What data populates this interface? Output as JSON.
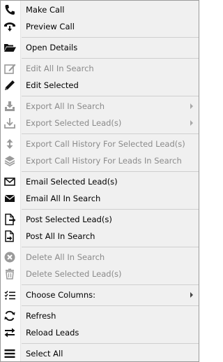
{
  "menu": {
    "make_call": "Make Call",
    "preview_call": "Preview Call",
    "open_details": "Open Details",
    "edit_all_in_search": "Edit All In Search",
    "edit_selected": "Edit Selected",
    "export_all_in_search": "Export All In Search",
    "export_selected_leads": "Export Selected Lead(s)",
    "export_call_history_selected": "Export Call History For Selected Lead(s)",
    "export_call_history_in_search": "Export Call History For Leads In Search",
    "email_selected_leads": "Email Selected Lead(s)",
    "email_all_in_search": "Email All In Search",
    "post_selected_leads": "Post Selected Lead(s)",
    "post_all_in_search": "Post All In Search",
    "delete_all_in_search": "Delete All In Search",
    "delete_selected_leads": "Delete Selected Lead(s)",
    "choose_columns": "Choose Columns:",
    "refresh": "Refresh",
    "reload_leads": "Reload Leads",
    "select_all": "Select All"
  },
  "icons": {
    "make_call": "phone-icon",
    "preview_call": "phone-down-arrow-icon",
    "open_details": "open-folder-icon",
    "edit_all_in_search": "edit-note-icon",
    "edit_selected": "pencil-icon",
    "export_all_in_search": "download-tray-icon",
    "export_selected_leads": "download-icon",
    "export_call_history_selected": "up-down-arrows-icon",
    "export_call_history_in_search": "layers-icon",
    "email_selected_leads": "envelope-outline-icon",
    "email_all_in_search": "envelope-filled-icon",
    "post_selected_leads": "document-arrow-icon",
    "post_all_in_search": "document-sign-icon",
    "delete_all_in_search": "x-circle-icon",
    "delete_selected_leads": "trash-icon",
    "choose_columns": "checklist-icon",
    "refresh": "refresh-icon",
    "reload_leads": "swap-arrows-icon",
    "select_all": "hamburger-icon"
  },
  "colors": {
    "enabled_text": "#000000",
    "disabled_text": "#8a8a8a",
    "enabled_icon": "#111111",
    "disabled_icon": "#9a9a9a"
  }
}
